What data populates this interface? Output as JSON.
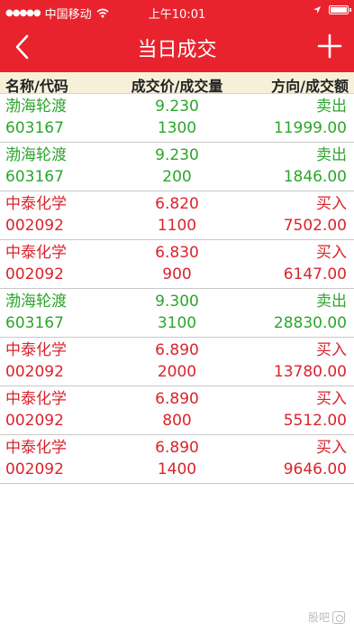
{
  "status_bar": {
    "carrier": "中国移动",
    "time": "上午10:01"
  },
  "nav": {
    "title": "当日成交"
  },
  "columns": {
    "name_code": "名称/代码",
    "price_qty": "成交价/成交量",
    "dir_amount": "方向/成交额"
  },
  "trades": [
    {
      "name": "渤海轮渡",
      "code": "603167",
      "price": "9.230",
      "qty": "1300",
      "direction": "卖出",
      "amount": "11999.00",
      "side": "sell"
    },
    {
      "name": "渤海轮渡",
      "code": "603167",
      "price": "9.230",
      "qty": "200",
      "direction": "卖出",
      "amount": "1846.00",
      "side": "sell"
    },
    {
      "name": "中泰化学",
      "code": "002092",
      "price": "6.820",
      "qty": "1100",
      "direction": "买入",
      "amount": "7502.00",
      "side": "buy"
    },
    {
      "name": "中泰化学",
      "code": "002092",
      "price": "6.830",
      "qty": "900",
      "direction": "买入",
      "amount": "6147.00",
      "side": "buy"
    },
    {
      "name": "渤海轮渡",
      "code": "603167",
      "price": "9.300",
      "qty": "3100",
      "direction": "卖出",
      "amount": "28830.00",
      "side": "sell"
    },
    {
      "name": "中泰化学",
      "code": "002092",
      "price": "6.890",
      "qty": "2000",
      "direction": "买入",
      "amount": "13780.00",
      "side": "buy"
    },
    {
      "name": "中泰化学",
      "code": "002092",
      "price": "6.890",
      "qty": "800",
      "direction": "买入",
      "amount": "5512.00",
      "side": "buy"
    },
    {
      "name": "中泰化学",
      "code": "002092",
      "price": "6.890",
      "qty": "1400",
      "direction": "买入",
      "amount": "9646.00",
      "side": "buy"
    }
  ],
  "colors": {
    "header_red": "#e8232e",
    "buy": "#d9242c",
    "sell": "#2ba62b",
    "column_header_bg": "#f6f0d9"
  },
  "watermark": {
    "text": "股吧",
    "icon": "watermark-logo-icon"
  },
  "icons": {
    "back": "back-chevron-icon",
    "add": "plus-icon",
    "wifi": "wifi-icon",
    "location": "location-arrow-icon",
    "battery": "battery-icon"
  }
}
